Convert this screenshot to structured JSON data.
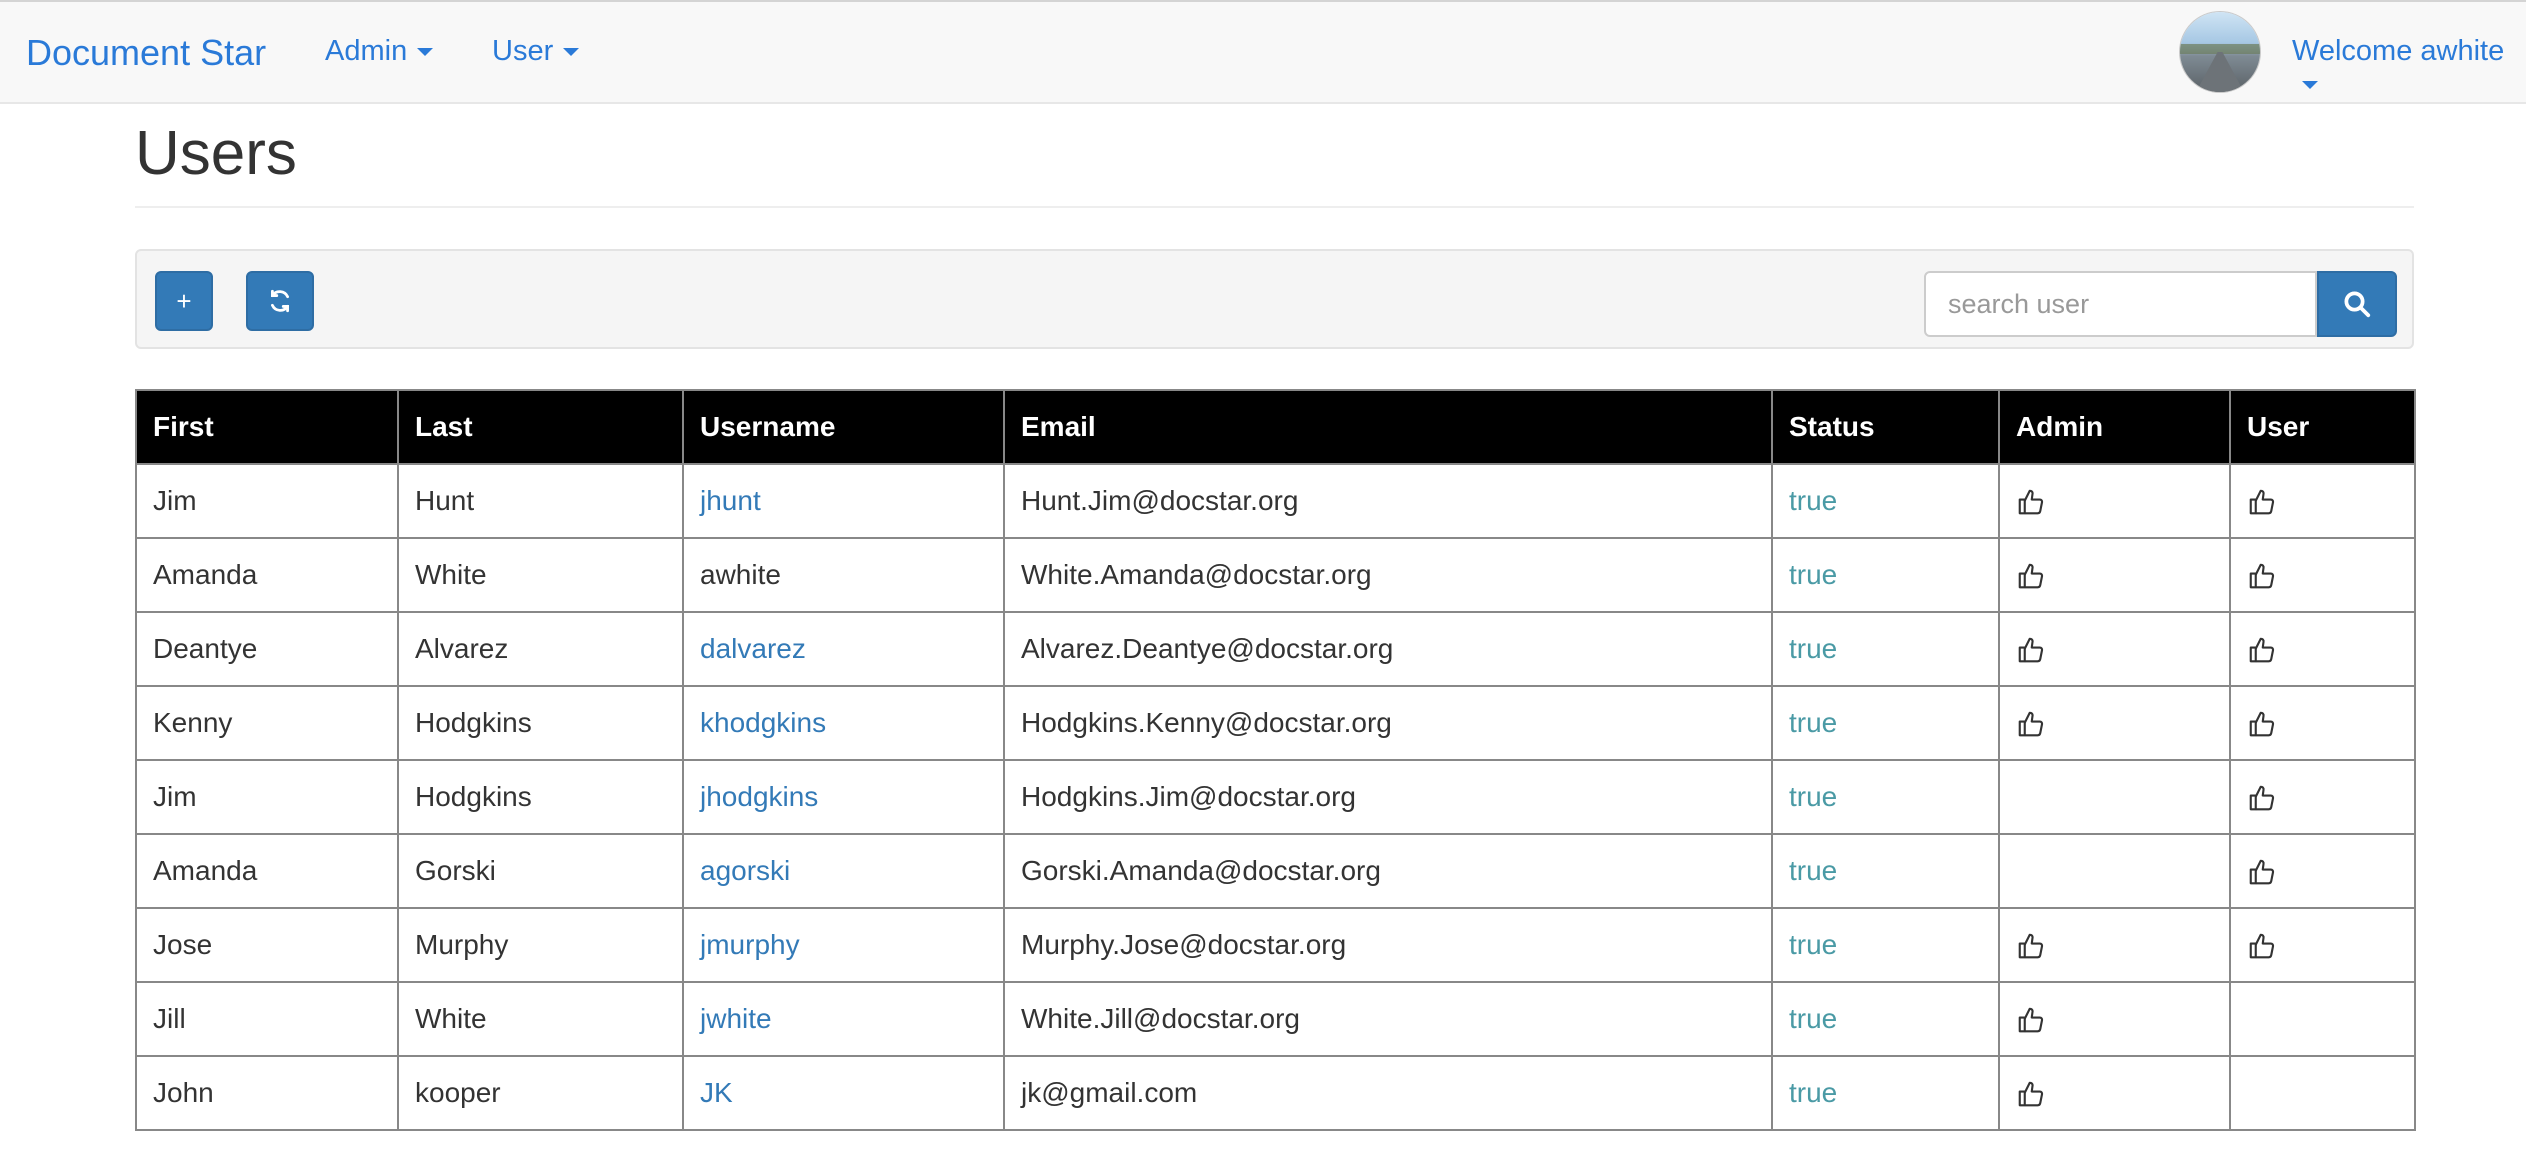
{
  "navbar": {
    "brand": "Document Star",
    "menus": [
      {
        "label": "Admin"
      },
      {
        "label": "User"
      }
    ],
    "welcome": "Welcome awhite"
  },
  "page": {
    "title": "Users"
  },
  "toolbar": {
    "add_label": "+",
    "search_placeholder": "search user"
  },
  "icons": {
    "refresh": "refresh-icon",
    "search": "search-icon",
    "thumb": "thumbs-up-icon"
  },
  "colors": {
    "brand": "#2a7ad8",
    "primary": "#337ab7",
    "status": "#4a9aa5",
    "header_bg": "#000000"
  },
  "table": {
    "headers": [
      "First",
      "Last",
      "Username",
      "Email",
      "Status",
      "Admin",
      "User"
    ],
    "rows": [
      {
        "first": "Jim",
        "last": "Hunt",
        "username": "jhunt",
        "username_link": true,
        "email": "Hunt.Jim@docstar.org",
        "status": "true",
        "admin": true,
        "user": true
      },
      {
        "first": "Amanda",
        "last": "White",
        "username": "awhite",
        "username_link": false,
        "email": "White.Amanda@docstar.org",
        "status": "true",
        "admin": true,
        "user": true
      },
      {
        "first": "Deantye",
        "last": "Alvarez",
        "username": "dalvarez",
        "username_link": true,
        "email": "Alvarez.Deantye@docstar.org",
        "status": "true",
        "admin": true,
        "user": true
      },
      {
        "first": "Kenny",
        "last": "Hodgkins",
        "username": "khodgkins",
        "username_link": true,
        "email": "Hodgkins.Kenny@docstar.org",
        "status": "true",
        "admin": true,
        "user": true
      },
      {
        "first": "Jim",
        "last": "Hodgkins",
        "username": "jhodgkins",
        "username_link": true,
        "email": "Hodgkins.Jim@docstar.org",
        "status": "true",
        "admin": false,
        "user": true
      },
      {
        "first": "Amanda",
        "last": "Gorski",
        "username": "agorski",
        "username_link": true,
        "email": "Gorski.Amanda@docstar.org",
        "status": "true",
        "admin": false,
        "user": true
      },
      {
        "first": "Jose",
        "last": "Murphy",
        "username": "jmurphy",
        "username_link": true,
        "email": "Murphy.Jose@docstar.org",
        "status": "true",
        "admin": true,
        "user": true
      },
      {
        "first": "Jill",
        "last": "White",
        "username": "jwhite",
        "username_link": true,
        "email": "White.Jill@docstar.org",
        "status": "true",
        "admin": true,
        "user": false
      },
      {
        "first": "John",
        "last": "kooper",
        "username": "JK",
        "username_link": true,
        "email": "jk@gmail.com",
        "status": "true",
        "admin": true,
        "user": false
      }
    ]
  }
}
